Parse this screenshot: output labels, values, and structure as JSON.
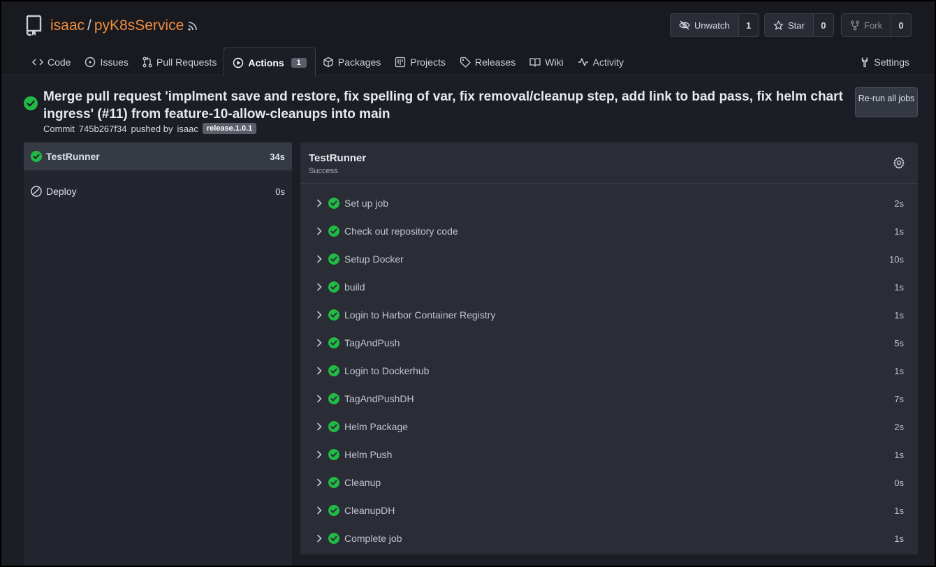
{
  "repo": {
    "owner": "isaac",
    "separator": "/",
    "name": "pyK8sService"
  },
  "actions_buttons": [
    {
      "label": "Unwatch",
      "count": "1",
      "icon": "eye-slash-icon",
      "disabled": false
    },
    {
      "label": "Star",
      "count": "0",
      "icon": "star-icon",
      "disabled": false
    },
    {
      "label": "Fork",
      "count": "0",
      "icon": "fork-icon",
      "disabled": true
    }
  ],
  "tabs": [
    {
      "label": "Code",
      "icon": "code-icon"
    },
    {
      "label": "Issues",
      "icon": "issue-icon"
    },
    {
      "label": "Pull Requests",
      "icon": "pull-request-icon"
    },
    {
      "label": "Actions",
      "icon": "play-icon",
      "badge": "1",
      "active": true
    },
    {
      "label": "Packages",
      "icon": "package-icon"
    },
    {
      "label": "Projects",
      "icon": "project-icon"
    },
    {
      "label": "Releases",
      "icon": "tag-icon"
    },
    {
      "label": "Wiki",
      "icon": "book-icon"
    },
    {
      "label": "Activity",
      "icon": "pulse-icon"
    }
  ],
  "settings_label": "Settings",
  "run": {
    "title": "Merge pull request 'implment save and restore, fix spelling of var, fix removal/cleanup step, add link to bad pass, fix helm chart ingress' (#11) from feature-10-allow-cleanups into main",
    "commit_prefix": "Commit",
    "commit_sha": "745b267f34",
    "pushed_by": "pushed by",
    "user": "isaac",
    "label": "release.1.0.1",
    "rerun_label": "Re-run all jobs"
  },
  "jobs": [
    {
      "name": "TestRunner",
      "duration": "34s",
      "status": "success",
      "active": true
    },
    {
      "name": "Deploy",
      "duration": "0s",
      "status": "skipped",
      "active": false
    }
  ],
  "panel": {
    "title": "TestRunner",
    "subtitle": "Success",
    "steps": [
      {
        "name": "Set up job",
        "duration": "2s"
      },
      {
        "name": "Check out repository code",
        "duration": "1s"
      },
      {
        "name": "Setup Docker",
        "duration": "10s"
      },
      {
        "name": "build",
        "duration": "1s"
      },
      {
        "name": "Login to Harbor Container Registry",
        "duration": "1s"
      },
      {
        "name": "TagAndPush",
        "duration": "5s"
      },
      {
        "name": "Login to Dockerhub",
        "duration": "1s"
      },
      {
        "name": "TagAndPushDH",
        "duration": "7s"
      },
      {
        "name": "Helm Package",
        "duration": "2s"
      },
      {
        "name": "Helm Push",
        "duration": "1s"
      },
      {
        "name": "Cleanup",
        "duration": "0s"
      },
      {
        "name": "CleanupDH",
        "duration": "1s"
      },
      {
        "name": "Complete job",
        "duration": "1s"
      }
    ]
  },
  "colors": {
    "accent_orange": "#f08c3e",
    "success_green": "#21ba45",
    "background": "#1c1e25"
  }
}
